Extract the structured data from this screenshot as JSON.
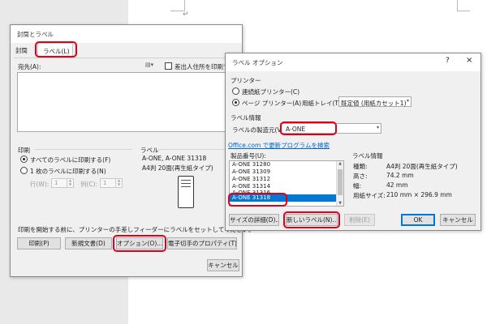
{
  "left_dialog": {
    "title": "封筒とラベル",
    "tabs": {
      "envelope": "封筒",
      "label": "ラベル(L)"
    },
    "address_label": "宛先(A):",
    "use_return_address": "差出人住所を印刷する",
    "print_section": "印刷",
    "print_all": "すべてのラベルに印刷する(F)",
    "print_single": "1 枚のラベルに印刷する(N)",
    "row_label": "行(W):",
    "row_value": "1",
    "col_label": "列(C):",
    "col_value": "1",
    "label_section": "ラベル",
    "label_name": "A-ONE, A-ONE 31318",
    "label_desc": "A4判 20面(再生紙タイプ)",
    "instructions": "印刷を開始する前に、プリンターの手差しフィーダーにラベルをセットしてください。",
    "buttons": {
      "print": "印刷(P)",
      "new_document": "新規文書(D)",
      "options": "オプション(O)...",
      "postage": "電子切手のプロパティ(T)...",
      "cancel": "キャンセル"
    }
  },
  "right_dialog": {
    "title": "ラベル オプション",
    "help": "?",
    "close": "×",
    "printer_section": "プリンター",
    "continuous_printer": "連続紙プリンター(C)",
    "page_printer": "ページ プリンター(A)",
    "tray_label": "用紙トレイ(T):",
    "tray_value": "既定値 (用紙カセット1)",
    "label_info_section": "ラベル情報",
    "vendor_label": "ラベルの製造元(V):",
    "vendor_value": "A-ONE",
    "office_link": "Office.com で更新プログラムを検索",
    "product_label": "製品番号(U):",
    "products": [
      "A-ONE 31280",
      "A-ONE 31309",
      "A-ONE 31312",
      "A-ONE 31314",
      "A-ONE 31316",
      "A-ONE 31318"
    ],
    "info_title": "ラベル情報",
    "info": {
      "type_label": "種類:",
      "type_value": "A4判 20面(再生紙タイプ)",
      "height_label": "高さ:",
      "height_value": "74.2 mm",
      "width_label": "幅:",
      "width_value": "42 mm",
      "page_size_label": "用紙サイズ:",
      "page_size_value": "210 mm × 296.9 mm"
    },
    "buttons": {
      "details": "サイズの詳細(D)...",
      "new_label": "新しいラベル(N)...",
      "delete": "削除(E)",
      "ok": "OK",
      "cancel": "キャンセル"
    }
  },
  "document": {
    "return_mark": "↵"
  },
  "colors": {
    "highlight": "#e0001a",
    "selection": "#0078d7",
    "link": "#0066cc"
  }
}
